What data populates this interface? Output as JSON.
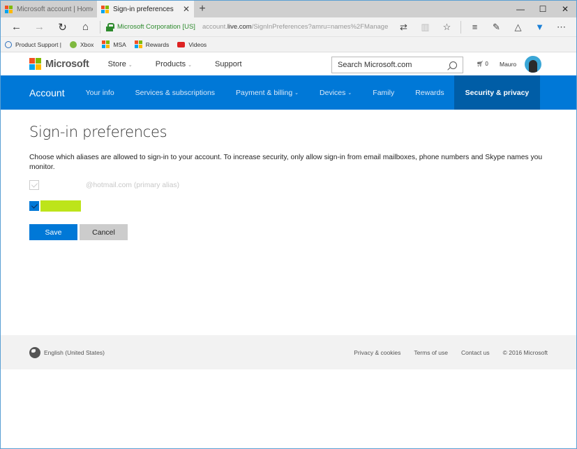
{
  "browser": {
    "tabs": [
      {
        "title": "Microsoft account | Home",
        "active": false
      },
      {
        "title": "Sign-in preferences",
        "active": true
      }
    ],
    "new_tab_icon": "plus-icon",
    "window_controls": {
      "minimize": "—",
      "maximize": "☐",
      "close": "✕"
    },
    "nav": {
      "back": "←",
      "forward": "→",
      "refresh": "↻",
      "home": "⌂"
    },
    "identity": "Microsoft Corporation [US]",
    "url_prefix": "account.",
    "url_domain": "live.com",
    "url_path": "/SignInPreferences?amru=names%2FManage",
    "tools": [
      "translate-icon",
      "reading-view-icon",
      "favorite-star-icon",
      "hub-icon",
      "web-note-icon",
      "share-icon",
      "extension-icon",
      "more-icon"
    ],
    "favorites": [
      {
        "label": "Product Support |",
        "icon": "support-icon"
      },
      {
        "label": "Xbox",
        "icon": "xbox-icon"
      },
      {
        "label": "MSA",
        "icon": "microsoft-icon"
      },
      {
        "label": "Rewards",
        "icon": "microsoft-icon"
      },
      {
        "label": "Videos",
        "icon": "youtube-icon"
      }
    ]
  },
  "site_header": {
    "brand": "Microsoft",
    "nav": [
      {
        "label": "Store",
        "has_dropdown": true
      },
      {
        "label": "Products",
        "has_dropdown": true
      },
      {
        "label": "Support",
        "has_dropdown": false
      }
    ],
    "search_placeholder": "Search Microsoft.com",
    "cart_count": "0",
    "user_name": "Mauro"
  },
  "account_nav": {
    "brand": "Account",
    "items": [
      {
        "label": "Your info",
        "dropdown": false
      },
      {
        "label": "Services & subscriptions",
        "dropdown": false
      },
      {
        "label": "Payment & billing",
        "dropdown": true
      },
      {
        "label": "Devices",
        "dropdown": true
      },
      {
        "label": "Family",
        "dropdown": false
      },
      {
        "label": "Rewards",
        "dropdown": false
      },
      {
        "label": "Security & privacy",
        "dropdown": false,
        "active": true
      }
    ]
  },
  "page": {
    "title": "Sign-in preferences",
    "description": "Choose which aliases are allowed to sign-in to your account. To increase security, only allow sign-in from email mailboxes, phone numbers and Skype names you monitor.",
    "aliases": [
      {
        "label": "@hotmail.com (primary alias)",
        "checked": true,
        "disabled": true
      },
      {
        "label": "",
        "checked": true,
        "disabled": false,
        "redacted": true
      }
    ],
    "save_label": "Save",
    "cancel_label": "Cancel"
  },
  "footer": {
    "language": "English (United States)",
    "links": [
      "Privacy & cookies",
      "Terms of use",
      "Contact us"
    ],
    "copyright": "© 2016 Microsoft"
  },
  "colors": {
    "accent": "#0078d7",
    "active_nav": "#005da6",
    "redaction": "#bde41a"
  }
}
